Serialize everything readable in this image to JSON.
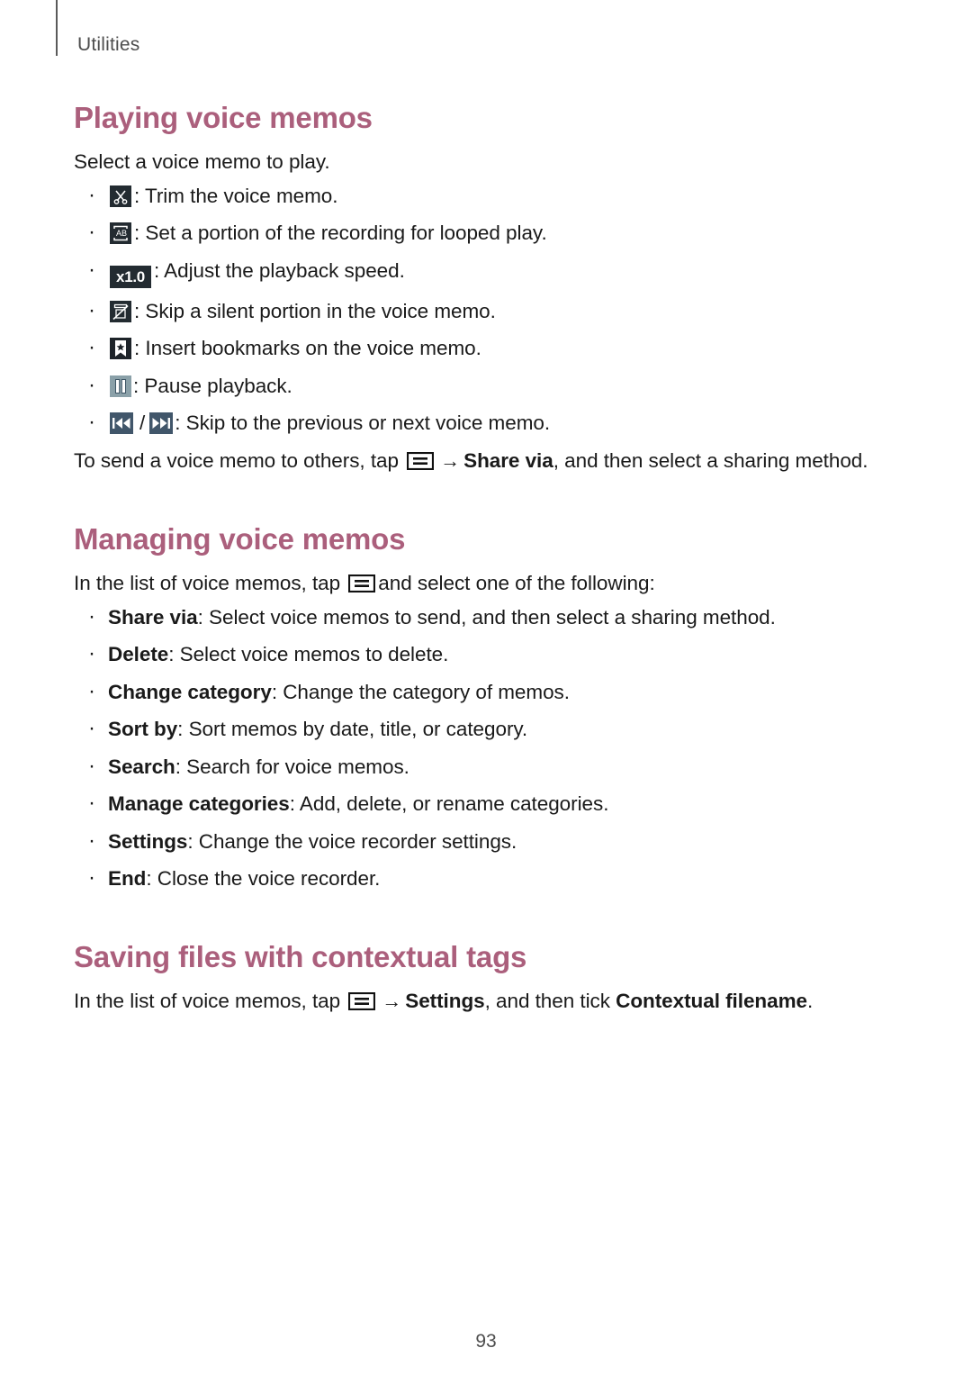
{
  "header": {
    "chapter_label": "Utilities"
  },
  "colors": {
    "heading": "#ab5f7c",
    "body_text": "#1a1a1a",
    "header_text": "#4d4d4d",
    "icon_dark": "#232b31",
    "icon_slate": "#41566a",
    "icon_pause": "#8aa0a8"
  },
  "sections": [
    {
      "id": "playing-voice-memos",
      "title": "Playing voice memos",
      "intro": "Select a voice memo to play.",
      "bullets": [
        {
          "icon": "trim-scissors-icon",
          "text": ": Trim the voice memo."
        },
        {
          "icon": "ab-repeat-icon",
          "text": ": Set a portion of the recording for looped play."
        },
        {
          "icon": "playback-speed-icon",
          "icon_label": "x1.0",
          "text": ": Adjust the playback speed."
        },
        {
          "icon": "skip-silence-icon",
          "text": ": Skip a silent portion in the voice memo."
        },
        {
          "icon": "bookmark-icon",
          "text": ": Insert bookmarks on the voice memo."
        },
        {
          "icon": "pause-icon",
          "text": ": Pause playback."
        },
        {
          "icon": "previous-next-icon",
          "text": ": Skip to the previous or next voice memo."
        }
      ],
      "outro": {
        "before_icon": "To send a voice memo to others, tap ",
        "arrow": "→",
        "bold_term": "Share via",
        "after": ", and then select a sharing method."
      }
    },
    {
      "id": "managing-voice-memos",
      "title": "Managing voice memos",
      "intro": {
        "before_icon": "In the list of voice memos, tap ",
        "after_icon": "and select one of the following:"
      },
      "bullets": [
        {
          "term": "Share via",
          "desc": ": Select voice memos to send, and then select a sharing method."
        },
        {
          "term": "Delete",
          "desc": ": Select voice memos to delete."
        },
        {
          "term": "Change category",
          "desc": ": Change the category of memos."
        },
        {
          "term": "Sort by",
          "desc": ": Sort memos by date, title, or category."
        },
        {
          "term": "Search",
          "desc": ": Search for voice memos."
        },
        {
          "term": "Manage categories",
          "desc": ": Add, delete, or rename categories."
        },
        {
          "term": "Settings",
          "desc": ": Change the voice recorder settings."
        },
        {
          "term": "End",
          "desc": ": Close the voice recorder."
        }
      ]
    },
    {
      "id": "saving-files-with-contextual-tags",
      "title": "Saving files with contextual tags",
      "intro": {
        "before_icon": "In the list of voice memos, tap ",
        "arrow": "→",
        "bold_term_1": "Settings",
        "middle": ", and then tick ",
        "bold_term_2": "Contextual filename",
        "after": "."
      }
    }
  ],
  "footer": {
    "page_number": "93"
  }
}
